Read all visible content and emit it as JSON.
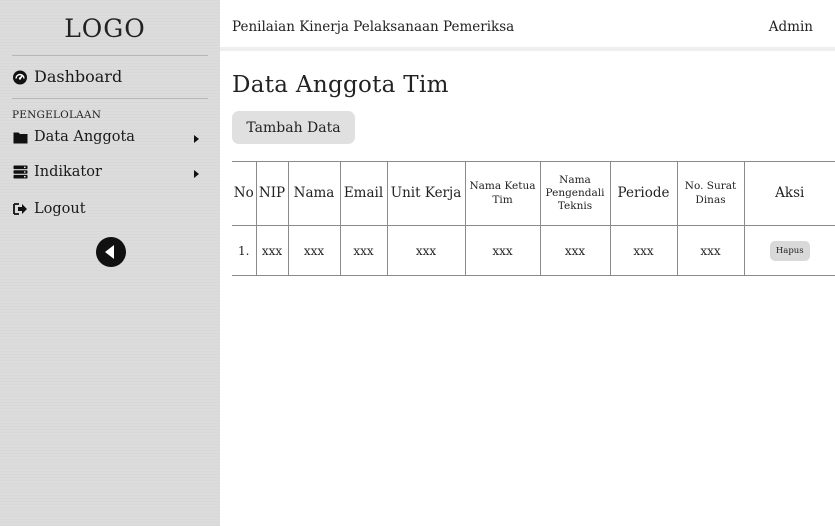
{
  "sidebar": {
    "logo": "LOGO",
    "dashboard_label": "Dashboard",
    "section_label": "PENGELOLAAN",
    "items": [
      {
        "label": "Data Anggota",
        "icon": "folder-icon"
      },
      {
        "label": "Indikator",
        "icon": "server-icon"
      },
      {
        "label": "Logout",
        "icon": "sign-out-icon"
      }
    ],
    "collapse_icon": "chevron-left-circle-icon"
  },
  "header": {
    "title": "Penilaian Kinerja Pelaksanaan Pemeriksa",
    "user": "Admin"
  },
  "main": {
    "page_title": "Data Anggota Tim",
    "add_button": "Tambah Data",
    "table": {
      "columns": [
        "No",
        "NIP",
        "Nama",
        "Email",
        "Unit Kerja",
        "Nama Ketua Tim",
        "Nama Pengendali Teknis",
        "Periode",
        "No. Surat Dinas",
        "Aksi"
      ],
      "rows": [
        {
          "cells": [
            "1.",
            "xxx",
            "xxx",
            "xxx",
            "xxx",
            "xxx",
            "xxx",
            "xxx",
            "xxx"
          ],
          "action": "Hapus"
        }
      ]
    }
  },
  "colors": {
    "sidebar_bg": "#dcdcdc",
    "button_bg": "#e0e0e0",
    "border": "#8a8a8a"
  }
}
